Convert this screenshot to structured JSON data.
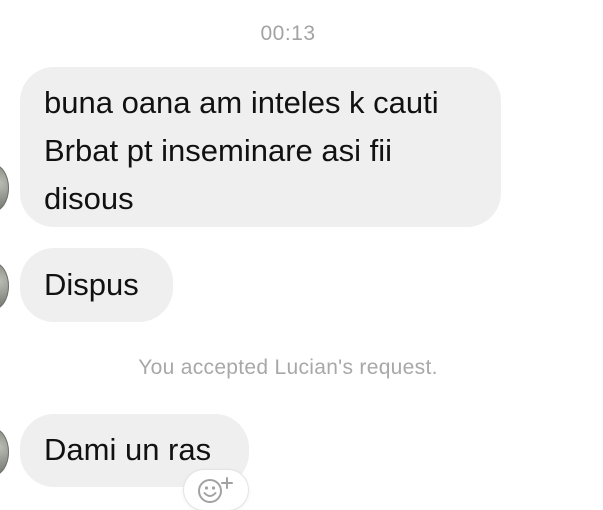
{
  "thread": {
    "timestamp": "00:13",
    "messages": [
      {
        "text": "buna oana am inteles k cauti Brbat pt inseminare asi fii disous"
      },
      {
        "text": "Dispus"
      },
      {
        "text": "Dami un ras"
      }
    ],
    "system_notice": "You accepted Lucian's request."
  },
  "icons": {
    "reaction": "add-reaction-icon",
    "avatar": "sender-avatar"
  },
  "colors": {
    "bubble_background": "#efefef",
    "meta_text": "#a3a3a3"
  }
}
